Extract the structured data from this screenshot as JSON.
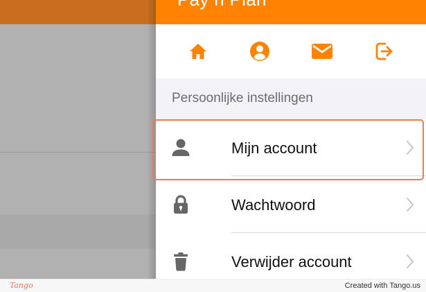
{
  "panel": {
    "title": "Pay n Plan"
  },
  "icon_bar": {
    "items": [
      {
        "icon": "home-icon"
      },
      {
        "icon": "account-circle-icon"
      },
      {
        "icon": "mail-icon"
      },
      {
        "icon": "logout-icon"
      }
    ]
  },
  "section": {
    "title": "Persoonlijke instellingen",
    "items": [
      {
        "label": "Mijn account",
        "icon": "person-icon",
        "highlighted": true
      },
      {
        "label": "Wachtwoord",
        "icon": "lock-icon",
        "highlighted": false
      },
      {
        "label": "Verwijder account",
        "icon": "trash-icon",
        "highlighted": false
      }
    ]
  },
  "footer": {
    "logo": "Tango",
    "credit": "Created with Tango.us"
  },
  "colors": {
    "accent": "#ff8200",
    "highlight_border": "#f07a50",
    "icon_gray": "#666666"
  }
}
